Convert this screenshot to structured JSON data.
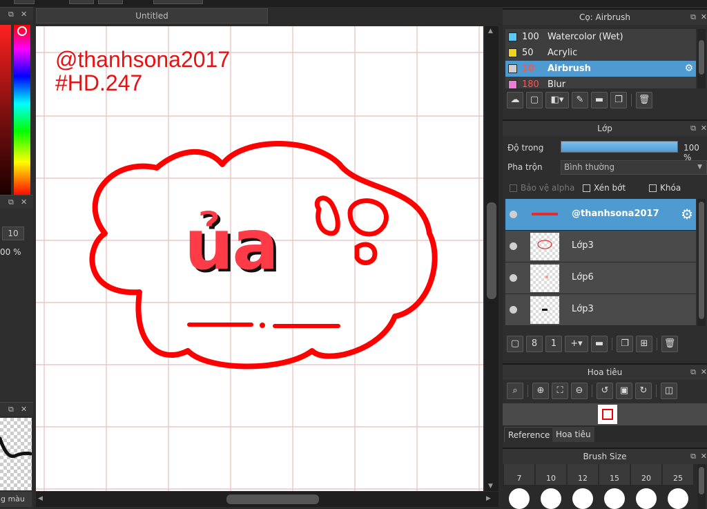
{
  "document": {
    "tab_title": "Untitled"
  },
  "canvas": {
    "watermark_line1": "@thanhsona2017",
    "watermark_line2": "#HD.247",
    "art_text": "ủa",
    "accent_color": "#ff0000"
  },
  "left_panel": {
    "brush_size_value": "10",
    "opacity_value": "00 %",
    "bottom_tab": "ng màu"
  },
  "brush_panel": {
    "title": "Cọ: Airbrush",
    "items": [
      {
        "size": "100",
        "name": "Watercolor (Wet)",
        "color": "#5bc8f5"
      },
      {
        "size": "50",
        "name": "Acrylic",
        "color": "#f0d21a"
      },
      {
        "size": "10",
        "name": "Airbrush",
        "color": "#cfcfcf",
        "selected": true
      },
      {
        "size": "180",
        "name": "Blur",
        "color": "#f07ad8"
      }
    ]
  },
  "layer_panel": {
    "title": "Lớp",
    "opacity_label": "Độ trong",
    "opacity_value": "100 %",
    "opacity_fraction": 1.0,
    "blend_label": "Pha trộn",
    "blend_value": "Bình thường",
    "protect_alpha": "Bảo vệ alpha",
    "clipping": "Xén bớt",
    "lock": "Khóa",
    "layers": [
      {
        "name": "@thanhsona2017",
        "selected": true
      },
      {
        "name": "Lớp3"
      },
      {
        "name": "Lớp6"
      },
      {
        "name": "Lớp3"
      }
    ]
  },
  "navigator_panel": {
    "title": "Hoa tiêu",
    "tabs": [
      "Reference",
      "Hoa tiêu"
    ]
  },
  "brush_size_panel": {
    "title": "Brush Size",
    "sizes": [
      "7",
      "10",
      "12",
      "15",
      "20",
      "25"
    ]
  },
  "colors": {
    "selection": "#4e9bd1",
    "panel_bg": "#2e2e2e"
  }
}
